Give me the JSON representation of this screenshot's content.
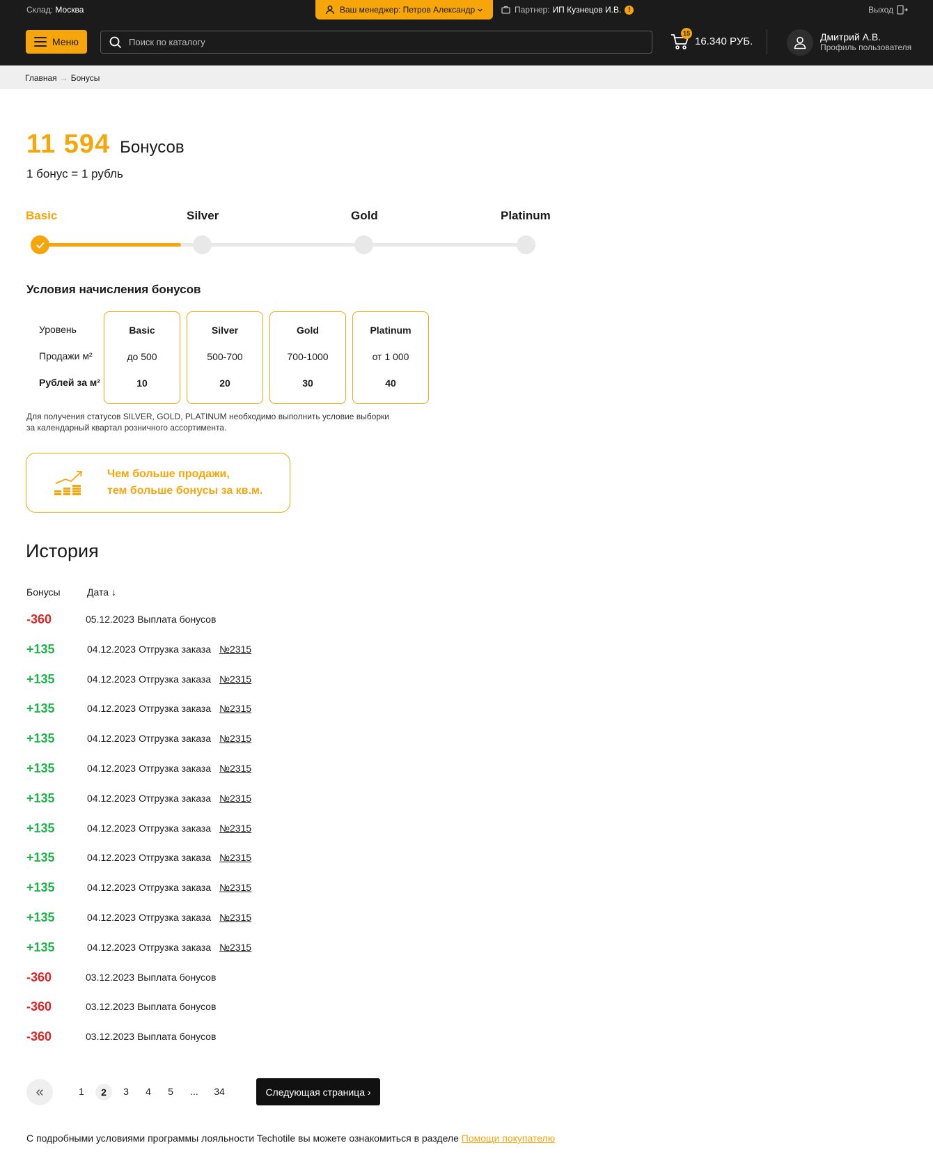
{
  "topbar": {
    "stock_label": "Склад:",
    "stock_value": "Москва",
    "manager": "Ваш менеджер: Петров Александр",
    "partner_label": "Партнер:",
    "partner_value": "ИП Кузнецов И.В.",
    "warn": "!",
    "logout": "Выход"
  },
  "header": {
    "menu_label": "Меню",
    "search_placeholder": "Поиск по каталогу",
    "cart_count": "15",
    "cart_sum": "16.340 РУБ.",
    "profile_name": "Дмитрий А.В.",
    "profile_sub": "Профиль пользователя"
  },
  "breadcrumb": {
    "home": "Главная",
    "sep": "→",
    "current": "Бонусы"
  },
  "bonus": {
    "amount": "11 594",
    "label": "Бонусов",
    "rate": "1 бонус = 1 рубль"
  },
  "levels": {
    "progress_percent": 29,
    "items": [
      "Basic",
      "Silver",
      "Gold",
      "Platinum"
    ],
    "active_index": 0
  },
  "conditions": {
    "title": "Условия начисления бонусов",
    "row_labels": [
      "Уровень",
      "Продажи м²",
      "Рублей за м²"
    ],
    "cards": [
      {
        "level": "Basic",
        "sales": "до 500",
        "rub": "10"
      },
      {
        "level": "Silver",
        "sales": "500-700",
        "rub": "20"
      },
      {
        "level": "Gold",
        "sales": "700-1000",
        "rub": "30"
      },
      {
        "level": "Platinum",
        "sales": "от 1 000",
        "rub": "40"
      }
    ],
    "note_line1": "Для получения статусов SILVER, GOLD, PLATINUM необходимо выполнить условие выборки",
    "note_line2": "за календарный квартал розничного ассортимента."
  },
  "promo": {
    "line1": "Чем больше продажи,",
    "line2": "тем больше бонусы за кв.м."
  },
  "history": {
    "title": "История",
    "col_bonus": "Бонусы",
    "col_date": "Дата ↓",
    "rows": [
      {
        "amount": "-360",
        "type": "neg",
        "date": "05.12.2023",
        "text": "Выплата бонусов",
        "link": ""
      },
      {
        "amount": "+135",
        "type": "pos",
        "date": "04.12.2023",
        "text": "Отгрузка заказа",
        "link": "№2315"
      },
      {
        "amount": "+135",
        "type": "pos",
        "date": "04.12.2023",
        "text": "Отгрузка заказа",
        "link": "№2315"
      },
      {
        "amount": "+135",
        "type": "pos",
        "date": "04.12.2023",
        "text": "Отгрузка заказа",
        "link": "№2315"
      },
      {
        "amount": "+135",
        "type": "pos",
        "date": "04.12.2023",
        "text": "Отгрузка заказа",
        "link": "№2315"
      },
      {
        "amount": "+135",
        "type": "pos",
        "date": "04.12.2023",
        "text": "Отгрузка заказа",
        "link": "№2315"
      },
      {
        "amount": "+135",
        "type": "pos",
        "date": "04.12.2023",
        "text": "Отгрузка заказа",
        "link": "№2315"
      },
      {
        "amount": "+135",
        "type": "pos",
        "date": "04.12.2023",
        "text": "Отгрузка заказа",
        "link": "№2315"
      },
      {
        "amount": "+135",
        "type": "pos",
        "date": "04.12.2023",
        "text": "Отгрузка заказа",
        "link": "№2315"
      },
      {
        "amount": "+135",
        "type": "pos",
        "date": "04.12.2023",
        "text": "Отгрузка заказа",
        "link": "№2315"
      },
      {
        "amount": "+135",
        "type": "pos",
        "date": "04.12.2023",
        "text": "Отгрузка заказа",
        "link": "№2315"
      },
      {
        "amount": "+135",
        "type": "pos",
        "date": "04.12.2023",
        "text": "Отгрузка заказа",
        "link": "№2315"
      },
      {
        "amount": "-360",
        "type": "neg",
        "date": "03.12.2023",
        "text": "Выплата бонусов",
        "link": ""
      },
      {
        "amount": "-360",
        "type": "neg",
        "date": "03.12.2023",
        "text": "Выплата бонусов",
        "link": ""
      },
      {
        "amount": "-360",
        "type": "neg",
        "date": "03.12.2023",
        "text": "Выплата бонусов",
        "link": ""
      }
    ]
  },
  "pagination": {
    "prev": "«",
    "pages": [
      "1",
      "2",
      "3",
      "4",
      "5",
      "...",
      "34"
    ],
    "current": "2",
    "next": "Следующая страница ›"
  },
  "footer": {
    "text": "С подробными условиями программы лояльности Techotile вы можете ознакомиться в разделе",
    "link": "Помощи покупателю"
  },
  "colors": {
    "accent": "#f6a50b",
    "dark": "#1b1b1b",
    "negative": "#e02424",
    "positive": "#1fb34a"
  }
}
